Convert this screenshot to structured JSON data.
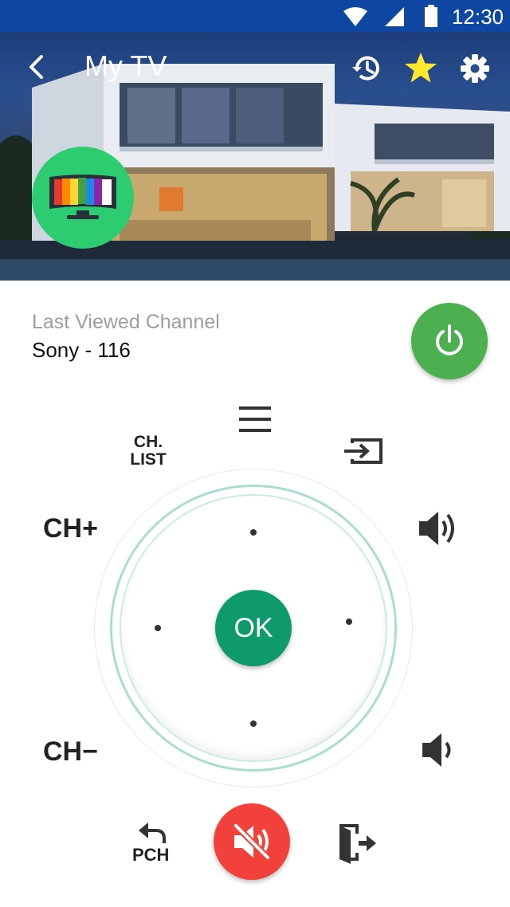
{
  "status_bar": {
    "time": "12:30",
    "icons": [
      "wifi-icon",
      "signal-icon",
      "battery-icon"
    ]
  },
  "header": {
    "title": "My TV",
    "icons": [
      "back-arrow-icon",
      "history-icon",
      "star-icon",
      "gear-icon"
    ],
    "badge_icon": "tv-icon"
  },
  "info": {
    "label": "Last Viewed Channel",
    "channel": "Sony - 116"
  },
  "remote": {
    "ch_list_line1": "CH.",
    "ch_list_line2": "LIST",
    "ch_plus": "CH+",
    "ch_minus": "CH−",
    "ok_label": "OK",
    "pch_label": "PCH"
  },
  "colors": {
    "power": "#4caf50",
    "ok": "#0e9a6a",
    "mute": "#f2413b",
    "badge": "#2ecc71",
    "star": "#ffe82e"
  }
}
